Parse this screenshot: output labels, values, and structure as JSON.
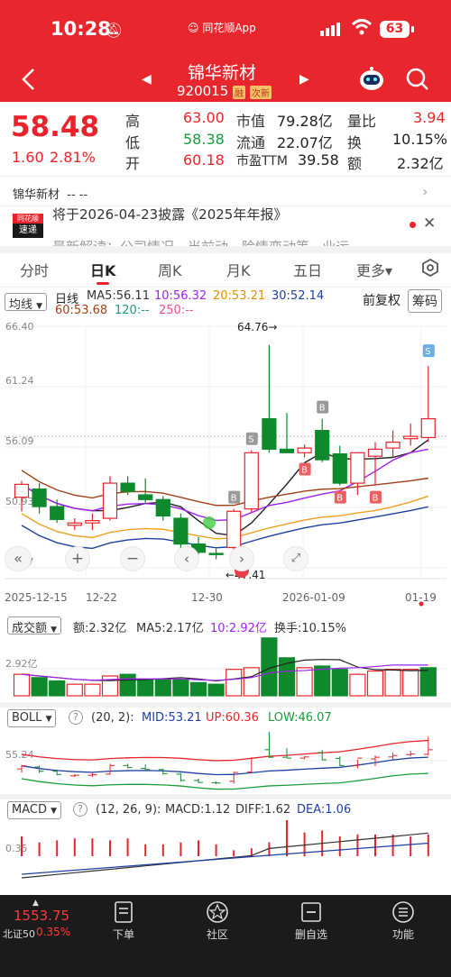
{
  "status_bar": {
    "time": "10:28",
    "center": "同花顺App",
    "battery": "63"
  },
  "header": {
    "title": "锦华新材",
    "code": "920015",
    "badge1": "融",
    "badge2": "次新"
  },
  "quote": {
    "price": "58.48",
    "change": "1.60",
    "change_pct": "2.81%",
    "high_label": "高",
    "high": "63.00",
    "low_label": "低",
    "low": "58.38",
    "open_label": "开",
    "open": "60.18",
    "mcap_label": "市值",
    "mcap": "79.28亿",
    "float_label": "流通",
    "float": "22.07亿",
    "pe_label": "市盈TTM",
    "pe": "39.58",
    "volratio_label": "量比",
    "volratio": "3.94",
    "turnover_label": "换",
    "turnover": "10.15%",
    "amount_label": "额",
    "amount": "2.32亿"
  },
  "info_row": {
    "name": "锦华新材",
    "dashes": "--  --"
  },
  "news": {
    "badge_top": "同花顺",
    "badge_bottom": "速递",
    "text": "将于2026-04-23披露《2025年年报》",
    "peek": "最新解读：公司情况、当前动、险情变动等...业运"
  },
  "tabs": [
    {
      "label": "分时",
      "active": false
    },
    {
      "label": "日K",
      "active": true
    },
    {
      "label": "周K",
      "active": false
    },
    {
      "label": "月K",
      "active": false
    },
    {
      "label": "五日",
      "active": false
    },
    {
      "label": "更多▾",
      "active": false
    }
  ],
  "ma_legend": {
    "selector": "均线",
    "period": "日线",
    "ma5": "MA5:56.11",
    "ma10": "10:56.32",
    "ma20": "20:53.21",
    "ma30": "30:52.14",
    "ma60": "60:53.68",
    "ma120": "120:--",
    "ma250": "250:--",
    "adjust": "前复权",
    "chip": "筹码"
  },
  "colors": {
    "up": "#e8232b",
    "down": "#0e8a2c",
    "ma5": "#222222",
    "ma10": "#a020f0",
    "ma20": "#f0a020",
    "ma30": "#1f3fa0",
    "ma60": "#a0401a"
  },
  "kline_axis": {
    "y_labels": [
      "66.40",
      "61.24",
      "56.09",
      "50.93",
      "45.77"
    ],
    "x_labels": [
      "2025-12-15",
      "12-22",
      "12-30",
      "2026-01-09",
      "01-19"
    ],
    "max_label": "64.76→",
    "min_label": "←47.41"
  },
  "chart_data": [
    {
      "type": "candlestick",
      "title": "日K",
      "ylim": [
        45.77,
        66.4
      ],
      "ohlc": [
        [
          51.8,
          53.2,
          50.6,
          52.9
        ],
        [
          52.5,
          53.0,
          50.4,
          51.0
        ],
        [
          51.0,
          51.6,
          49.6,
          49.9
        ],
        [
          49.4,
          50.0,
          49.0,
          49.6
        ],
        [
          49.6,
          50.4,
          49.0,
          49.8
        ],
        [
          50.0,
          53.6,
          49.8,
          53.0
        ],
        [
          53.0,
          53.6,
          52.0,
          52.3
        ],
        [
          52.0,
          53.4,
          51.2,
          51.6
        ],
        [
          51.6,
          51.9,
          49.8,
          50.2
        ],
        [
          50.0,
          50.4,
          47.4,
          47.8
        ],
        [
          47.8,
          48.4,
          46.9,
          47.1
        ],
        [
          47.0,
          47.4,
          46.5,
          46.9
        ],
        [
          47.5,
          50.8,
          46.7,
          50.6
        ],
        [
          50.8,
          55.8,
          50.5,
          55.6
        ],
        [
          58.5,
          64.8,
          55.6,
          55.9
        ],
        [
          55.9,
          59.0,
          55.7,
          55.6
        ],
        [
          55.6,
          56.3,
          55.2,
          56.0
        ],
        [
          57.5,
          58.5,
          54.8,
          55.0
        ],
        [
          55.5,
          56.2,
          52.8,
          53.0
        ],
        [
          53.0,
          55.0,
          52.0,
          55.6
        ],
        [
          55.3,
          56.5,
          52.8,
          55.9
        ],
        [
          56.0,
          57.5,
          55.2,
          56.5
        ],
        [
          56.8,
          58.1,
          56.2,
          57.0
        ],
        [
          56.9,
          63.0,
          56.5,
          58.5
        ]
      ],
      "markers": [
        {
          "index": 12,
          "label": "B"
        },
        {
          "index": 13,
          "label": "S"
        },
        {
          "index": 16,
          "label": "B"
        },
        {
          "index": 17,
          "label": "B"
        },
        {
          "index": 18,
          "label": "B"
        },
        {
          "index": 20,
          "label": "B"
        },
        {
          "index": 23,
          "label": "S"
        }
      ]
    },
    {
      "type": "bar",
      "title": "成交额",
      "ylabel": "2.92亿",
      "values": [
        1.3,
        1.1,
        0.9,
        0.7,
        0.7,
        1.2,
        1.3,
        1.0,
        1.0,
        1.0,
        0.8,
        0.7,
        1.6,
        1.7,
        3.5,
        2.3,
        1.7,
        1.8,
        1.6,
        1.3,
        1.5,
        1.6,
        1.6,
        1.7
      ],
      "up": [
        true,
        false,
        false,
        true,
        true,
        true,
        false,
        false,
        false,
        false,
        false,
        false,
        true,
        true,
        false,
        false,
        true,
        false,
        false,
        true,
        true,
        true,
        true,
        false
      ]
    }
  ],
  "volume_legend": {
    "selector": "成交额",
    "amount": "额:2.32亿",
    "ma5": "MA5:2.17亿",
    "ma10": "10:2.92亿",
    "turnover": "换手:10.15%",
    "y_label": "2.92亿"
  },
  "boll_legend": {
    "selector": "BOLL",
    "help": "?",
    "params": "(20, 2):",
    "mid": "MID:53.21",
    "up": "UP:60.36",
    "low": "LOW:46.07",
    "y_label": "55.24"
  },
  "macd_legend": {
    "selector": "MACD",
    "help": "?",
    "params": "(12, 26, 9):",
    "macd": "MACD:1.12",
    "diff": "DIFF:1.62",
    "dea": "DEA:1.06",
    "y_label": "0.35"
  },
  "bottom_nav": {
    "index_value": "1553.75",
    "index_name": "北证50",
    "index_change": "0.35%",
    "items": [
      "下单",
      "社区",
      "删自选",
      "功能"
    ]
  }
}
